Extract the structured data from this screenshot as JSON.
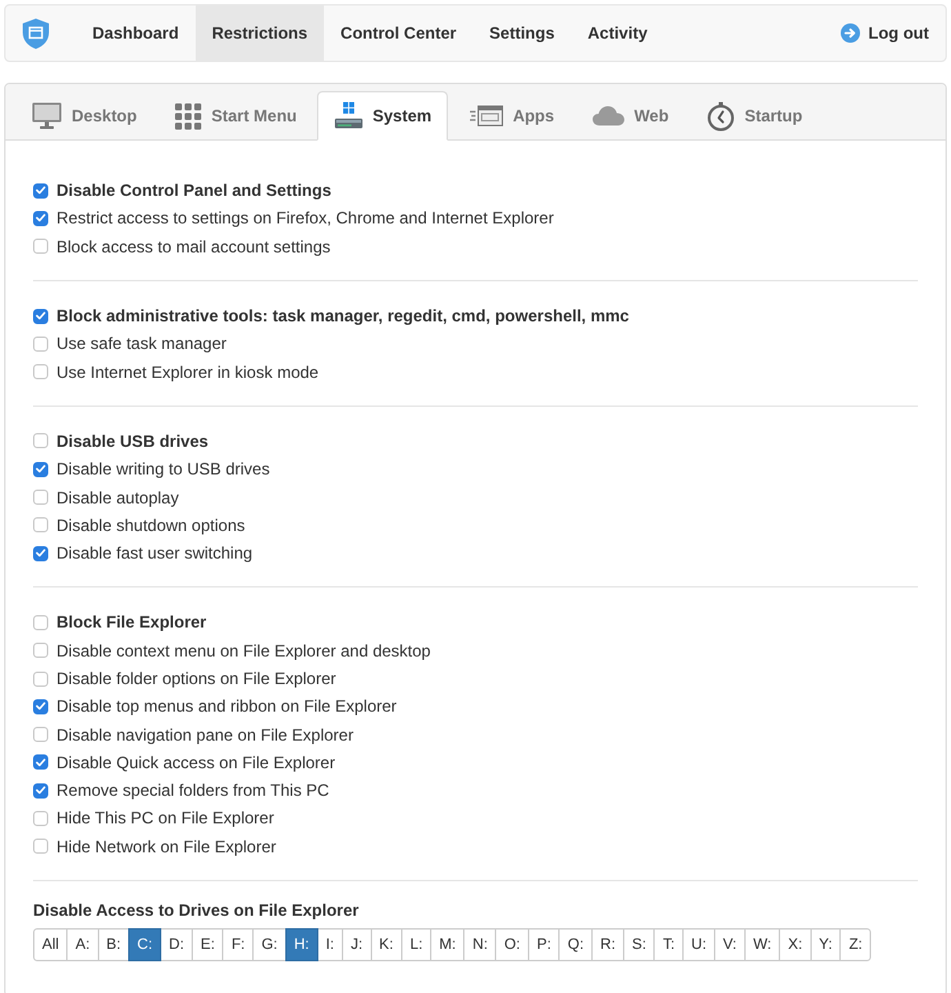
{
  "navbar": {
    "items": [
      {
        "label": "Dashboard",
        "selected": false
      },
      {
        "label": "Restrictions",
        "selected": true
      },
      {
        "label": "Control Center",
        "selected": false
      },
      {
        "label": "Settings",
        "selected": false
      },
      {
        "label": "Activity",
        "selected": false
      }
    ],
    "logout": "Log out"
  },
  "tabs": [
    {
      "label": "Desktop",
      "selected": false
    },
    {
      "label": "Start Menu",
      "selected": false
    },
    {
      "label": "System",
      "selected": true
    },
    {
      "label": "Apps",
      "selected": false
    },
    {
      "label": "Web",
      "selected": false
    },
    {
      "label": "Startup",
      "selected": false
    }
  ],
  "groups": [
    {
      "title": {
        "label": "Disable Control Panel and Settings",
        "checked": true
      },
      "options": [
        {
          "label": "Restrict access to settings on Firefox, Chrome and Internet Explorer",
          "checked": true
        },
        {
          "label": "Block access to mail account settings",
          "checked": false
        }
      ]
    },
    {
      "title": {
        "label": "Block administrative tools: task manager, regedit, cmd, powershell, mmc",
        "checked": true
      },
      "options": [
        {
          "label": "Use safe task manager",
          "checked": false
        },
        {
          "label": "Use Internet Explorer in kiosk mode",
          "checked": false
        }
      ]
    },
    {
      "title": {
        "label": "Disable USB drives",
        "checked": false
      },
      "options": [
        {
          "label": "Disable writing to USB drives",
          "checked": true
        },
        {
          "label": "Disable autoplay",
          "checked": false
        },
        {
          "label": "Disable shutdown options",
          "checked": false
        },
        {
          "label": "Disable fast user switching",
          "checked": true
        }
      ]
    },
    {
      "title": {
        "label": "Block File Explorer",
        "checked": false
      },
      "options": [
        {
          "label": "Disable context menu on File Explorer and desktop",
          "checked": false
        },
        {
          "label": "Disable folder options on File Explorer",
          "checked": false
        },
        {
          "label": "Disable top menus and ribbon on File Explorer",
          "checked": true
        },
        {
          "label": "Disable navigation pane on File Explorer",
          "checked": false
        },
        {
          "label": "Disable Quick access on File Explorer",
          "checked": true
        },
        {
          "label": "Remove special folders from This PC",
          "checked": true
        },
        {
          "label": "Hide This PC on File Explorer",
          "checked": false
        },
        {
          "label": "Hide Network on File Explorer",
          "checked": false
        }
      ]
    }
  ],
  "drives": {
    "title": "Disable Access to Drives on File Explorer",
    "buttons": [
      {
        "label": "All",
        "selected": false
      },
      {
        "label": "A:",
        "selected": false
      },
      {
        "label": "B:",
        "selected": false
      },
      {
        "label": "C:",
        "selected": true
      },
      {
        "label": "D:",
        "selected": false
      },
      {
        "label": "E:",
        "selected": false
      },
      {
        "label": "F:",
        "selected": false
      },
      {
        "label": "G:",
        "selected": false
      },
      {
        "label": "H:",
        "selected": true
      },
      {
        "label": "I:",
        "selected": false
      },
      {
        "label": "J:",
        "selected": false
      },
      {
        "label": "K:",
        "selected": false
      },
      {
        "label": "L:",
        "selected": false
      },
      {
        "label": "M:",
        "selected": false
      },
      {
        "label": "N:",
        "selected": false
      },
      {
        "label": "O:",
        "selected": false
      },
      {
        "label": "P:",
        "selected": false
      },
      {
        "label": "Q:",
        "selected": false
      },
      {
        "label": "R:",
        "selected": false
      },
      {
        "label": "S:",
        "selected": false
      },
      {
        "label": "T:",
        "selected": false
      },
      {
        "label": "U:",
        "selected": false
      },
      {
        "label": "V:",
        "selected": false
      },
      {
        "label": "W:",
        "selected": false
      },
      {
        "label": "X:",
        "selected": false
      },
      {
        "label": "Y:",
        "selected": false
      },
      {
        "label": "Z:",
        "selected": false
      }
    ]
  }
}
